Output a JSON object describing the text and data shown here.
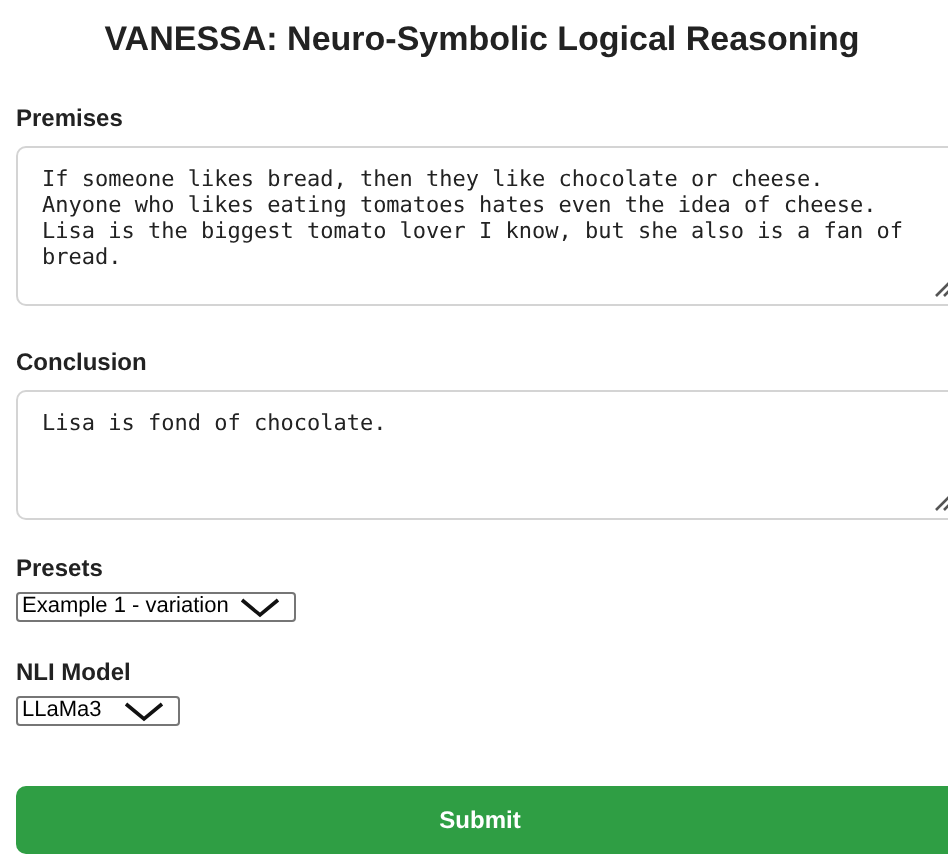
{
  "title": "VANESSA: Neuro-Symbolic Logical Reasoning",
  "premises": {
    "label": "Premises",
    "value": "If someone likes bread, then they like chocolate or cheese.\nAnyone who likes eating tomatoes hates even the idea of cheese.\nLisa is the biggest tomato lover I know, but she also is a fan of bread."
  },
  "conclusion": {
    "label": "Conclusion",
    "value": "Lisa is fond of chocolate."
  },
  "presets": {
    "label": "Presets",
    "value": "Example 1 - variation"
  },
  "nli_model": {
    "label": "NLI Model",
    "value": "LLaMa3"
  },
  "submit": {
    "label": "Submit"
  }
}
